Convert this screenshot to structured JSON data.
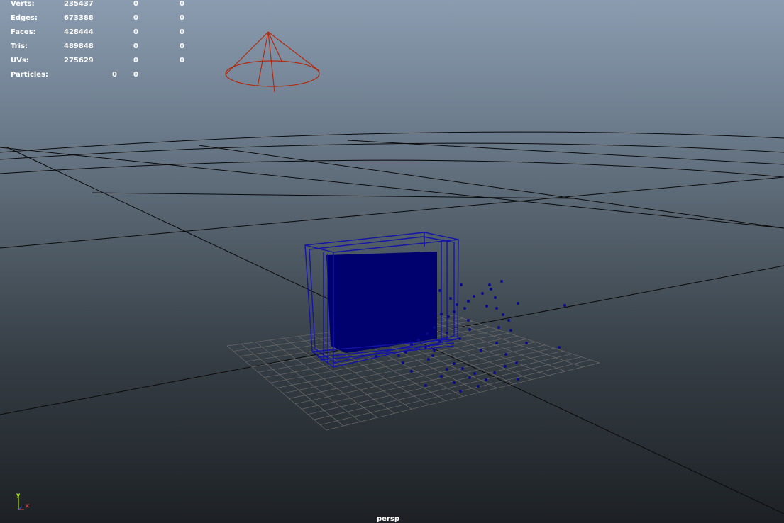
{
  "hud": {
    "rows": [
      {
        "label": "Verts:",
        "v1": "235437",
        "v2": "0",
        "v3": "0"
      },
      {
        "label": "Edges:",
        "v1": "673388",
        "v2": "0",
        "v3": "0"
      },
      {
        "label": "Faces:",
        "v1": "428444",
        "v2": "0",
        "v3": "0"
      },
      {
        "label": "Tris:",
        "v1": "489848",
        "v2": "0",
        "v3": "0"
      },
      {
        "label": "UVs:",
        "v1": "275629",
        "v2": "0",
        "v3": "0"
      }
    ],
    "particles": {
      "label": "Particles:",
      "v1": "0",
      "v2": "0"
    }
  },
  "camera_name": "persp",
  "axis": {
    "y": "y",
    "x": "x"
  },
  "colors": {
    "mesh": "#0c0c8a",
    "mesh_fill": "#000066",
    "light": "#b22a0e",
    "grid_line": "#0a0a0a",
    "ground_grid": "#6a6a6a",
    "text": "#ffffff",
    "axis_y": "#c8ff00",
    "axis_x": "#ff3333"
  },
  "icons": {
    "light": "spot-light-icon",
    "axis": "axis-gizmo-icon"
  }
}
